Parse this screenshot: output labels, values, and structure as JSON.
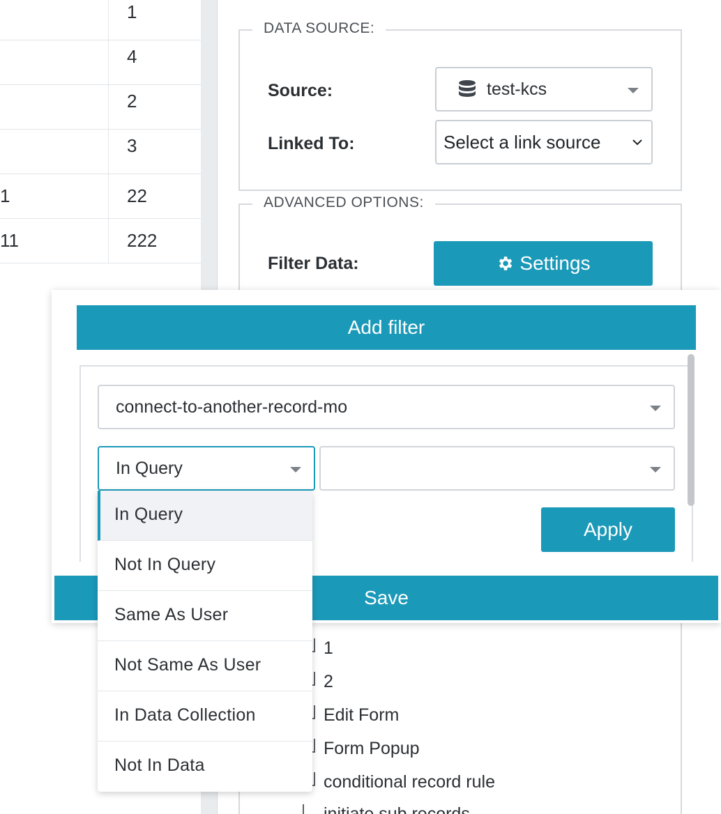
{
  "left_table": {
    "rows": [
      {
        "c1": "",
        "c2": "1"
      },
      {
        "c1": "",
        "c2": "4"
      },
      {
        "c1": "",
        "c2": "2"
      },
      {
        "c1": "",
        "c2": "3"
      },
      {
        "c1": "1",
        "c2": "22"
      },
      {
        "c1": "11",
        "c2": "222"
      }
    ]
  },
  "data_source": {
    "legend": "DATA SOURCE:",
    "source_label": "Source:",
    "source_value": "test-kcs",
    "linked_label": "Linked To:",
    "linked_value": "Select a link source"
  },
  "advanced": {
    "legend": "ADVANCED OPTIONS:",
    "filter_label": "Filter Data:",
    "settings_label": "Settings"
  },
  "tree": {
    "items": [
      "1",
      "2",
      "Edit Form",
      "Form Popup",
      "conditional record rule",
      "initiate sub records"
    ]
  },
  "filter_modal": {
    "add_filter_label": "Add filter",
    "field_value": "connect-to-another-record-mo",
    "operator_value": "In Query",
    "value_value": "",
    "apply_label": "Apply",
    "save_label": "Save"
  },
  "operator_dropdown": {
    "options": [
      "In Query",
      "Not In Query",
      "Same As User",
      "Not Same As User",
      "In Data Collection",
      "Not In Data"
    ],
    "selected": "In Query"
  },
  "colors": {
    "accent": "#1b99b8",
    "border": "#d6d9dd",
    "text": "#2b2f33"
  }
}
